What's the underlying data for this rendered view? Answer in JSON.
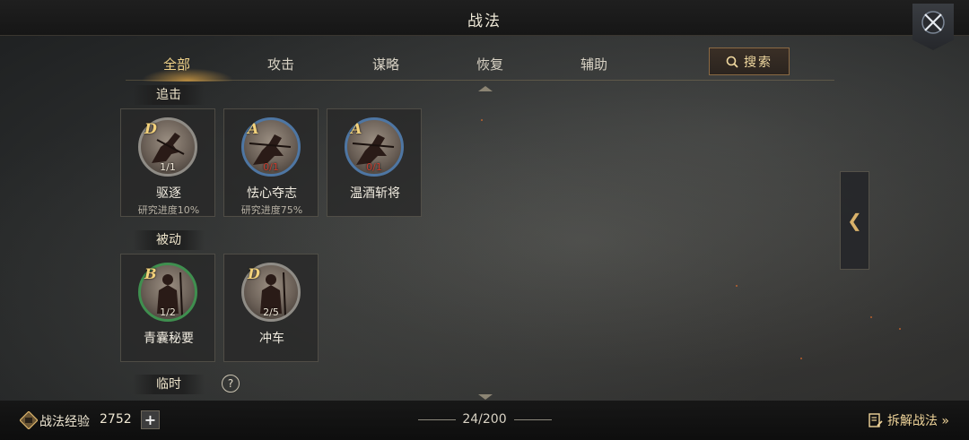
{
  "header": {
    "title": "战法"
  },
  "tabs": [
    {
      "label": "全部",
      "active": true
    },
    {
      "label": "攻击",
      "active": false
    },
    {
      "label": "谋略",
      "active": false
    },
    {
      "label": "恢复",
      "active": false
    },
    {
      "label": "辅助",
      "active": false
    }
  ],
  "search": {
    "label": "搜索"
  },
  "sections": {
    "pursuit": {
      "title": "追击"
    },
    "passive": {
      "title": "被动"
    },
    "temporary": {
      "title": "临时"
    }
  },
  "cards": {
    "pursuit": [
      {
        "name": "驱逐",
        "grade": "D",
        "level": "1/1",
        "progress": "研究进度10%",
        "ring_color": "grey"
      },
      {
        "name": "怯心夺志",
        "grade": "A",
        "level": "0/1",
        "progress": "研究进度75%",
        "ring_color": "blue"
      },
      {
        "name": "温酒斩将",
        "grade": "A",
        "level": "0/1",
        "progress": "",
        "ring_color": "blue"
      }
    ],
    "passive": [
      {
        "name": "青囊秘要",
        "grade": "B",
        "level": "1/2",
        "progress": "",
        "ring_color": "green"
      },
      {
        "name": "冲车",
        "grade": "D",
        "level": "2/5",
        "progress": "",
        "ring_color": "grey"
      }
    ]
  },
  "bottom": {
    "exp_label": "战法经验",
    "exp_value": "2752",
    "capacity": "24/200",
    "decompose_label": "拆解战法 »"
  },
  "colors": {
    "accent": "#f2d48a",
    "ring_blue": "#4e76a3",
    "ring_green": "#3f8f4f",
    "ring_grey": "#8f8c86"
  }
}
